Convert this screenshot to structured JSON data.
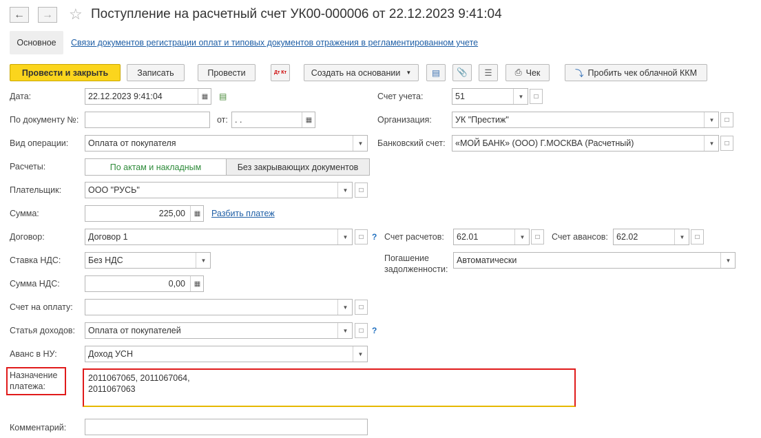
{
  "window": {
    "title": "Поступление на расчетный счет УК00-000006 от 22.12.2023 9:41:04"
  },
  "tabs": {
    "main": "Основное",
    "links": "Связи документов регистрации оплат и типовых документов отражения в регламентированном учете"
  },
  "toolbar": {
    "post_close": "Провести и закрыть",
    "save": "Записать",
    "post": "Провести",
    "dtkt": "Дт Кт",
    "create_based": "Создать на основании",
    "check": "Чек",
    "cloud_check": "Пробить чек облачной ККМ"
  },
  "form": {
    "date_label": "Дата:",
    "date_value": "22.12.2023  9:41:04",
    "doc_no_label": "По документу №:",
    "doc_no_value": "",
    "from_label": "от:",
    "from_value": " .  .",
    "operation_label": "Вид операции:",
    "operation_value": "Оплата от покупателя",
    "settlements_label": "Расчеты:",
    "settlements_option1": "По актам и накладным",
    "settlements_option2": "Без закрывающих документов",
    "payer_label": "Плательщик:",
    "payer_value": "ООО \"РУСЬ\"",
    "sum_label": "Сумма:",
    "sum_value": "225,00",
    "split_link": "Разбить платеж",
    "contract_label": "Договор:",
    "contract_value": "Договор 1",
    "vat_rate_label": "Ставка НДС:",
    "vat_rate_value": "Без НДС",
    "vat_sum_label": "Сумма НДС:",
    "vat_sum_value": "0,00",
    "invoice_label": "Счет на оплату:",
    "invoice_value": "",
    "income_item_label": "Статья доходов:",
    "income_item_value": "Оплата от покупателей",
    "advance_label": "Аванс в НУ:",
    "advance_value": "Доход УСН",
    "purpose_label": "Назначение платежа:",
    "purpose_line1": "2011067065, 2011067064,",
    "purpose_line2": "2011067063",
    "comment_label": "Комментарий:",
    "comment_value": "",
    "account_label": "Счет учета:",
    "account_value": "51",
    "org_label": "Организация:",
    "org_value": "УК \"Престиж\"",
    "bank_label": "Банковский счет:",
    "bank_value": "«МОЙ БАНК» (ООО) Г.МОСКВА (Расчетный)",
    "calc_account_label": "Счет расчетов:",
    "calc_account_value": "62.01",
    "advance_account_label": "Счет авансов:",
    "advance_account_value": "62.02",
    "repayment_label_line1": "Погашение",
    "repayment_label_line2": "задолженности:",
    "repayment_value": "Автоматически"
  },
  "colors": {
    "primary_button": "#fbd51d",
    "link": "#1f5fa6",
    "highlight": "#e01a1a",
    "selected_toggle_text": "#2e8b3a"
  }
}
